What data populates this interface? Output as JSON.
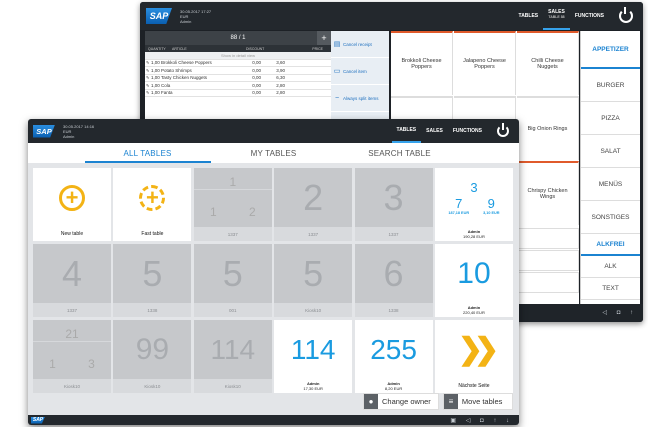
{
  "back_window": {
    "header": {
      "datetime": "30.05.2017 17:27",
      "location": "EUR",
      "user": "Admin",
      "nav": [
        "TABLES",
        "SALES",
        "FUNCTIONS"
      ],
      "sales_sub": "TABLE 88"
    },
    "receipt": {
      "title": "88 / 1",
      "columns": [
        "QUANTITY",
        "ARTICLE",
        "DISCOUNT",
        "PRICE"
      ],
      "subheader": "Show in detail view",
      "rows": [
        {
          "qty": "1,00",
          "article": "Brokkoli Cheese Poppers",
          "discount": "0,00",
          "price": "3,60"
        },
        {
          "qty": "1,00",
          "article": "Potato Shrimps",
          "discount": "0,00",
          "price": "3,90"
        },
        {
          "qty": "1,00",
          "article": "Tasty Chicken Nuggets",
          "discount": "0,00",
          "price": "6,30"
        },
        {
          "qty": "1,00",
          "article": "Cola",
          "discount": "0,00",
          "price": "2,80"
        },
        {
          "qty": "1,00",
          "article": "Fanta",
          "discount": "0,00",
          "price": "2,80"
        }
      ]
    },
    "actions": [
      "Cancel receipt",
      "Cancel item",
      "Always split items",
      "Return receipt by ID"
    ],
    "products": [
      "Brokkoli Cheese Poppers",
      "Jalapeno Cheese Poppers",
      "Chilli Cheese Nuggets",
      "",
      "",
      "Big Onion Rings",
      "",
      "",
      "Chrispy Chicken Wings"
    ],
    "small_items": [
      "ight",
      "Sport",
      "",
      "ate",
      "Bitter Lemon",
      "",
      "ber",
      "Johannis-beersaft",
      ""
    ],
    "categories": [
      "APPETIZER",
      "BURGER",
      "PIZZA",
      "SALAT",
      "MENÜS",
      "SONSTIGES",
      "ALKFREI",
      "ALK",
      "TEXT"
    ]
  },
  "front_window": {
    "header": {
      "datetime": "30.05.2017 14:16",
      "location": "EUR",
      "user": "Admin",
      "nav": [
        "TABLES",
        "SALES",
        "FUNCTIONS"
      ]
    },
    "tabs": [
      "ALL TABLES",
      "MY TABLES",
      "SEARCH TABLE"
    ],
    "tables": [
      {
        "label": "",
        "footer": "New table"
      },
      {
        "label": "",
        "footer": "Fast table"
      },
      {
        "label": "1",
        "sub": [
          "1",
          "2"
        ],
        "footer": "1337"
      },
      {
        "label": "2",
        "footer": "1337"
      },
      {
        "label": "3",
        "footer": "1337"
      },
      {
        "label": "3",
        "sub_left": "7",
        "sub_right": "9",
        "amount_left": "187,18 EUR",
        "amount_right": "3,10 EUR",
        "footer_user": "Admin",
        "footer_amount": "190,28 EUR"
      },
      {
        "label": "4",
        "footer": "1337"
      },
      {
        "label": "5",
        "footer": "1338"
      },
      {
        "label": "5",
        "footer": "001"
      },
      {
        "label": "5",
        "footer": "Kiosk10"
      },
      {
        "label": "6",
        "footer": "1338"
      },
      {
        "label": "10",
        "footer_user": "Admin",
        "footer_amount": "220,40 EUR"
      },
      {
        "label": "21",
        "sub": [
          "1",
          "3"
        ],
        "footer": "Kiosk10"
      },
      {
        "label": "99",
        "footer": "Kiosk10"
      },
      {
        "label": "114",
        "footer": "Kiosk10"
      },
      {
        "label": "114",
        "footer_user": "Admin",
        "footer_amount": "17,30 EUR"
      },
      {
        "label": "255",
        "footer_user": "Admin",
        "footer_amount": "8,20 EUR"
      },
      {
        "label": "",
        "footer": "Nächste Seite"
      }
    ],
    "buttons": {
      "change_owner": "Change owner",
      "move_tables": "Move tables"
    }
  },
  "colors": {
    "accent_blue": "#1b83d1",
    "yellow": "#f3b315",
    "product_border": "#e05a2b"
  }
}
